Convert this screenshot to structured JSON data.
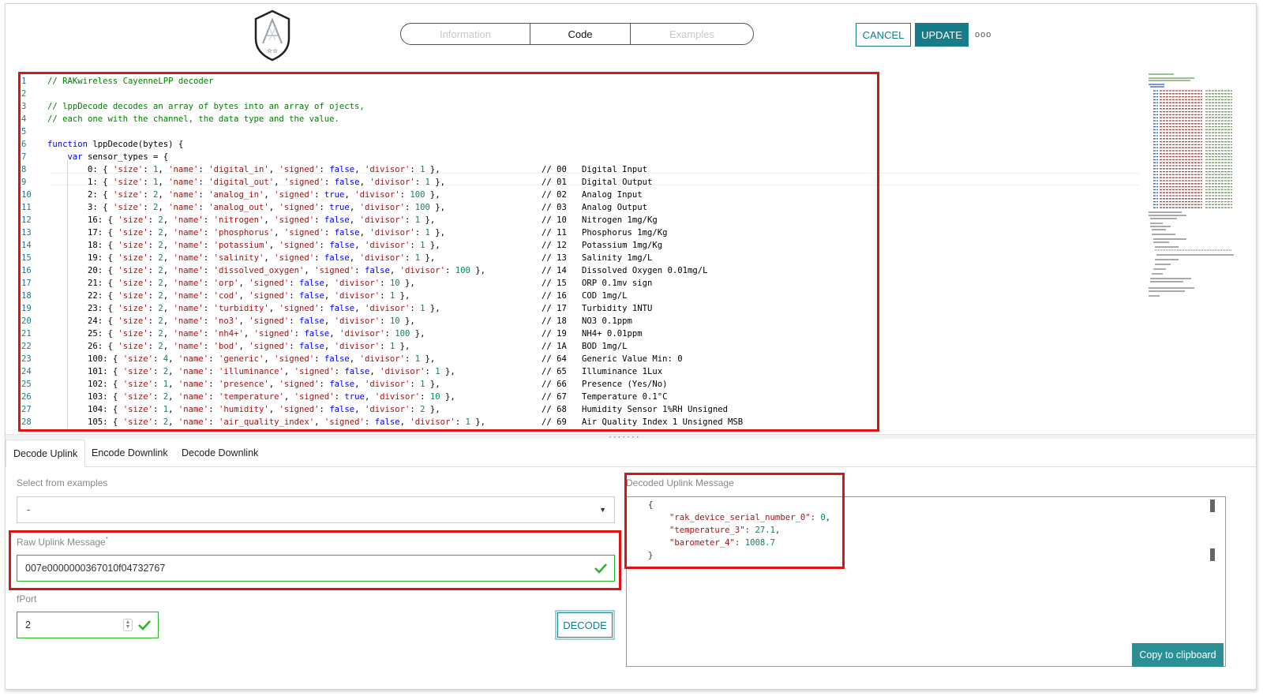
{
  "header": {
    "tabs": [
      {
        "label": "Information",
        "active": false
      },
      {
        "label": "Code",
        "active": true
      },
      {
        "label": "Examples",
        "active": false
      }
    ],
    "cancel_label": "CANCEL",
    "update_label": "UPDATE",
    "more_label": "ooo"
  },
  "colors": {
    "accent": "#177c8a",
    "highlight_box": "#e11212",
    "valid": "#2cb52c"
  },
  "editor": {
    "line_numbers": [
      "1",
      "2",
      "3",
      "4",
      "5",
      "6",
      "7",
      "8",
      "9",
      "10",
      "11",
      "12",
      "13",
      "14",
      "15",
      "16",
      "17",
      "18",
      "19",
      "20",
      "21",
      "22",
      "23",
      "24",
      "25",
      "26",
      "27",
      "28"
    ],
    "line1": "// RAKwireless CayenneLPP decoder",
    "line3": "// lppDecode decodes an array of bytes into an array of ojects,",
    "line4": "// each one with the channel, the data type and the value.",
    "line6_kw": "function",
    "line6_rest": " lppDecode(bytes) {",
    "line7_kw": "var",
    "line7_rest": " sensor_types = {",
    "sensor_rows": [
      {
        "id": "0",
        "size": "1",
        "name": "'digital_in'",
        "signed": "false",
        "divisor": "1",
        "hex": "00",
        "desc": "Digital Input"
      },
      {
        "id": "1",
        "size": "1",
        "name": "'digital_out'",
        "signed": "false",
        "divisor": "1",
        "hex": "01",
        "desc": "Digital Output"
      },
      {
        "id": "2",
        "size": "2",
        "name": "'analog_in'",
        "signed": "true",
        "divisor": "100",
        "hex": "02",
        "desc": "Analog Input"
      },
      {
        "id": "3",
        "size": "2",
        "name": "'analog_out'",
        "signed": "true",
        "divisor": "100",
        "hex": "03",
        "desc": "Analog Output"
      },
      {
        "id": "16",
        "size": "2",
        "name": "'nitrogen'",
        "signed": "false",
        "divisor": "1",
        "hex": "10",
        "desc": "Nitrogen 1mg/Kg"
      },
      {
        "id": "17",
        "size": "2",
        "name": "'phosphorus'",
        "signed": "false",
        "divisor": "1",
        "hex": "11",
        "desc": "Phosphorus 1mg/Kg"
      },
      {
        "id": "18",
        "size": "2",
        "name": "'potassium'",
        "signed": "false",
        "divisor": "1",
        "hex": "12",
        "desc": "Potassium 1mg/Kg"
      },
      {
        "id": "19",
        "size": "2",
        "name": "'salinity'",
        "signed": "false",
        "divisor": "1",
        "hex": "13",
        "desc": "Salinity 1mg/L"
      },
      {
        "id": "20",
        "size": "2",
        "name": "'dissolved_oxygen'",
        "signed": "false",
        "divisor": "100",
        "hex": "14",
        "desc": "Dissolved Oxygen 0.01mg/L"
      },
      {
        "id": "21",
        "size": "2",
        "name": "'orp'",
        "signed": "false",
        "divisor": "10",
        "hex": "15",
        "desc": "ORP 0.1mv sign"
      },
      {
        "id": "22",
        "size": "2",
        "name": "'cod'",
        "signed": "false",
        "divisor": "1",
        "hex": "16",
        "desc": "COD 1mg/L"
      },
      {
        "id": "23",
        "size": "2",
        "name": "'turbidity'",
        "signed": "false",
        "divisor": "1",
        "hex": "17",
        "desc": "Turbidity 1NTU"
      },
      {
        "id": "24",
        "size": "2",
        "name": "'no3'",
        "signed": "false",
        "divisor": "10",
        "hex": "18",
        "desc": "NO3 0.1ppm"
      },
      {
        "id": "25",
        "size": "2",
        "name": "'nh4+'",
        "signed": "false",
        "divisor": "100",
        "hex": "19",
        "desc": "NH4+ 0.01ppm"
      },
      {
        "id": "26",
        "size": "2",
        "name": "'bod'",
        "signed": "false",
        "divisor": "1",
        "hex": "1A",
        "desc": "BOD 1mg/L"
      },
      {
        "id": "100",
        "size": "4",
        "name": "'generic'",
        "signed": "false",
        "divisor": "1",
        "hex": "64",
        "desc": "Generic Value Min: 0"
      },
      {
        "id": "101",
        "size": "2",
        "name": "'illuminance'",
        "signed": "false",
        "divisor": "1",
        "hex": "65",
        "desc": "Illuminance 1Lux"
      },
      {
        "id": "102",
        "size": "1",
        "name": "'presence'",
        "signed": "false",
        "divisor": "1",
        "hex": "66",
        "desc": "Presence (Yes/No)"
      },
      {
        "id": "103",
        "size": "2",
        "name": "'temperature'",
        "signed": "true",
        "divisor": "10",
        "hex": "67",
        "desc": "Temperature 0.1°C"
      },
      {
        "id": "104",
        "size": "1",
        "name": "'humidity'",
        "signed": "false",
        "divisor": "2",
        "hex": "68",
        "desc": "Humidity Sensor 1%RH Unsigned"
      },
      {
        "id": "105",
        "size": "2",
        "name": "'air_quality_index'",
        "signed": "false",
        "divisor": "1",
        "hex": "69",
        "desc": "Air Quality Index 1 Unsigned MSB"
      }
    ]
  },
  "bottom": {
    "tabs": [
      {
        "label": "Decode Uplink",
        "active": true
      },
      {
        "label": "Encode Downlink",
        "active": false
      },
      {
        "label": "Decode Downlink",
        "active": false
      }
    ],
    "examples_label": "Select from examples",
    "examples_value": "-",
    "raw_label": "Raw Uplink Message",
    "raw_required": "*",
    "raw_value": "007e0000000367010f04732767",
    "fport_label": "fPort",
    "fport_value": "2",
    "decode_label": "DECODE",
    "output_label": "Decoded Uplink Message",
    "output_open": "{",
    "output_close": "}",
    "output_fields": [
      {
        "key": "\"rak_device_serial_number_0\"",
        "value": "0",
        "comma": ","
      },
      {
        "key": "\"temperature_3\"",
        "value": "27.1",
        "comma": ","
      },
      {
        "key": "\"barometer_4\"",
        "value": "1008.7",
        "comma": ""
      }
    ],
    "copy_label": "Copy to clipboard"
  }
}
